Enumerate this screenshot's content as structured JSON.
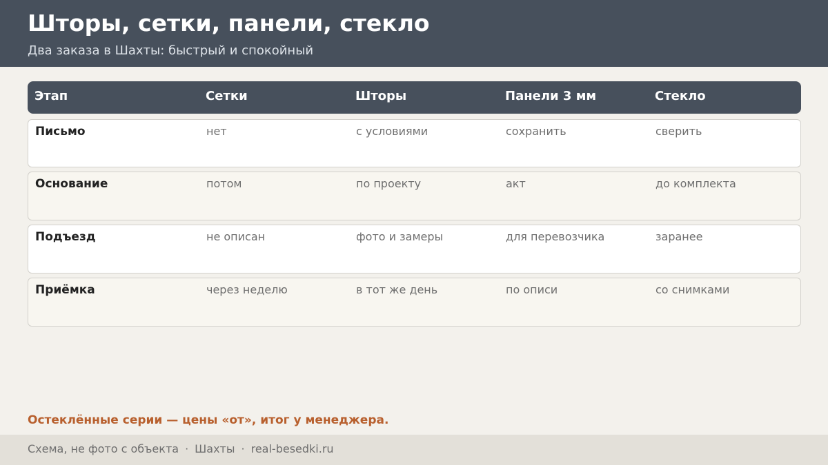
{
  "header": {
    "title": "Шторы, сетки, панели, стекло",
    "subtitle": "Два заказа в Шахты: быстрый и спокойный"
  },
  "table": {
    "columns": [
      "Этап",
      "Сетки",
      "Шторы",
      "Панели 3 мм",
      "Стекло"
    ],
    "rows": [
      [
        "Письмо",
        "нет",
        "с условиями",
        "сохранить",
        "сверить"
      ],
      [
        "Основание",
        "потом",
        "по проекту",
        "акт",
        "до комплекта"
      ],
      [
        "Подъезд",
        "не описан",
        "фото и замеры",
        "для перевозчика",
        "заранее"
      ],
      [
        "Приёмка",
        "через неделю",
        "в тот же день",
        "по описи",
        "со снимками"
      ]
    ]
  },
  "note": "Остеклённые серии — цены «от», итог у менеджера.",
  "footer": {
    "items": [
      "Схема, не фото с объекта",
      "Шахты",
      "real-besedki.ru"
    ],
    "separator": "·"
  }
}
